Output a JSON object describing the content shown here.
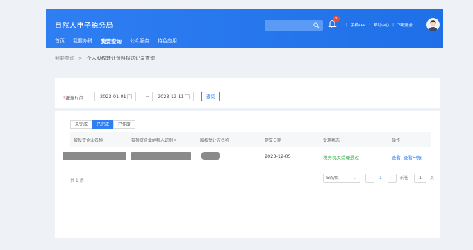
{
  "header": {
    "title": "自然人电子税务局",
    "nav": [
      "首页",
      "我要办税",
      "我要查询",
      "公众服务",
      "特色应用"
    ],
    "active_nav_index": 2,
    "notification_count": "20",
    "links": [
      "手机APP",
      "帮助中心",
      "下载服务"
    ]
  },
  "breadcrumb": {
    "parent": "我要查询",
    "separator": ">",
    "current": "个人股权转让资料报送记录查询"
  },
  "filter": {
    "required_mark": "*",
    "label": "报送时间",
    "start_date": "2023-01-01",
    "end_date": "2023-12-11",
    "query_label": "查询"
  },
  "tabs": {
    "items": [
      "未完成",
      "已完成",
      "已作废"
    ],
    "active_index": 1
  },
  "table": {
    "headers": [
      "被投资企业名称",
      "被投资企业纳税人识别号",
      "股权受让方名称",
      "提交日期",
      "受理状态",
      "操作"
    ],
    "rows": [
      {
        "submit_date": "2023-12-05",
        "status": "税务机关受理通过",
        "action_view": "查看",
        "action_apply": "查看申报"
      }
    ]
  },
  "pagination": {
    "total_label": "共 1 条",
    "page_size": "5条/页",
    "current_page": "1",
    "goto_label": "前往",
    "goto_value": "1",
    "page_suffix": "页"
  },
  "colors": {
    "brand": "#2f7ef2",
    "status_success": "#35b24a",
    "badge": "#f04b3a"
  }
}
